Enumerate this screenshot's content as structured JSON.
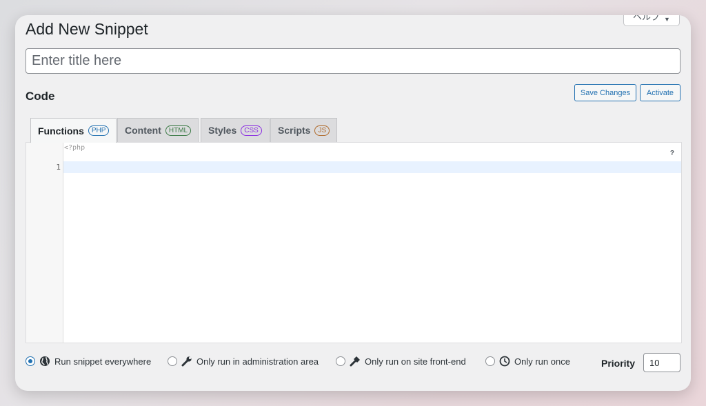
{
  "header": {
    "title": "Add New Snippet",
    "help_label": "ヘルプ",
    "help_caret": "▼"
  },
  "title_field": {
    "placeholder": "Enter title here",
    "value": ""
  },
  "code_section": {
    "heading": "Code",
    "save_label": "Save Changes",
    "activate_label": "Activate"
  },
  "tabs": [
    {
      "label": "Functions",
      "badge": "PHP",
      "active": true
    },
    {
      "label": "Content",
      "badge": "HTML",
      "active": false
    },
    {
      "label": "Styles",
      "badge": "CSS",
      "active": false
    },
    {
      "label": "Scripts",
      "badge": "JS",
      "active": false
    }
  ],
  "editor": {
    "open_tag": "<?php",
    "line_number": "1",
    "help_mark": "?"
  },
  "scope_options": [
    {
      "label": "Run snippet everywhere",
      "icon": "globe-icon",
      "checked": true
    },
    {
      "label": "Only run in administration area",
      "icon": "wrench-icon",
      "checked": false
    },
    {
      "label": "Only run on site front-end",
      "icon": "hammer-icon",
      "checked": false
    },
    {
      "label": "Only run once",
      "icon": "clock-icon",
      "checked": false
    }
  ],
  "priority": {
    "label": "Priority",
    "value": "10"
  },
  "colors": {
    "accent": "#2271b1",
    "panel_bg": "#f0f0f1",
    "active_line": "#e8f2ff"
  }
}
